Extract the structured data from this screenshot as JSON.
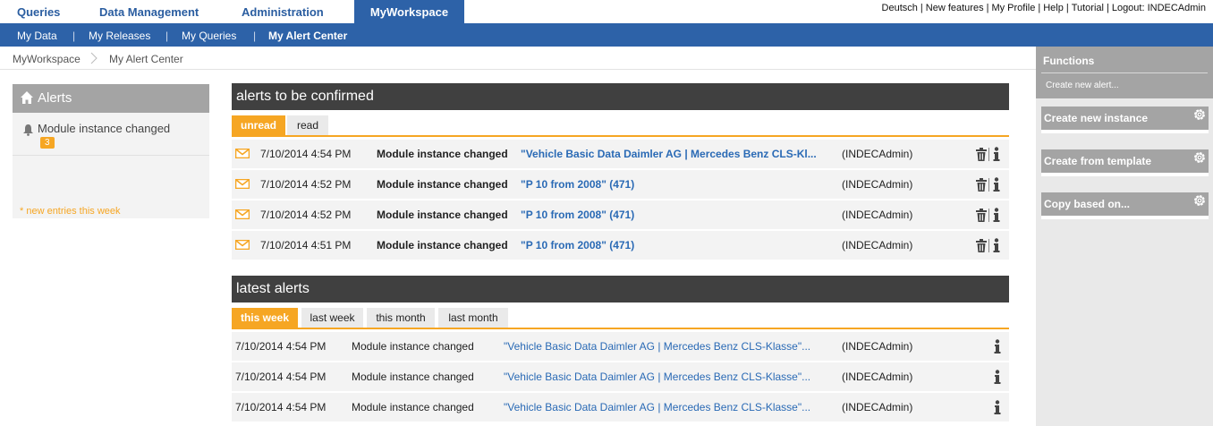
{
  "topnav": {
    "tabs": [
      {
        "label": "Queries"
      },
      {
        "label": "Data Management"
      },
      {
        "label": "Administration"
      },
      {
        "label": "MyWorkspace"
      }
    ],
    "utilities": {
      "language": "Deutsch",
      "new_features": "New features",
      "profile": "My Profile",
      "help": "Help",
      "tutorial": "Tutorial",
      "logout": "Logout: INDECAdmin"
    }
  },
  "subnav": {
    "items": [
      {
        "label": "My Data"
      },
      {
        "label": "My Releases"
      },
      {
        "label": "My Queries"
      },
      {
        "label": "My Alert Center"
      }
    ],
    "separator": "|"
  },
  "breadcrumb": [
    "MyWorkspace",
    "My Alert Center"
  ],
  "alerts_panel": {
    "title": "Alerts",
    "item_label": "Module instance changed",
    "item_count": "3",
    "note": "* new entries this week"
  },
  "confirm_section": {
    "title": "alerts to be confirmed",
    "tabs": [
      "unread",
      "read"
    ],
    "rows": [
      {
        "date": "7/10/2014 4:54 PM",
        "type": "Module instance changed",
        "target": "\"Vehicle Basic Data Daimler AG | Mercedes Benz CLS-Kl...",
        "user": "(INDECAdmin)"
      },
      {
        "date": "7/10/2014 4:52 PM",
        "type": "Module instance changed",
        "target": "\"P 10 from 2008\" (471)",
        "user": "(INDECAdmin)"
      },
      {
        "date": "7/10/2014 4:52 PM",
        "type": "Module instance changed",
        "target": "\"P 10 from 2008\" (471)",
        "user": "(INDECAdmin)"
      },
      {
        "date": "7/10/2014 4:51 PM",
        "type": "Module instance changed",
        "target": "\"P 10 from 2008\" (471)",
        "user": "(INDECAdmin)"
      }
    ]
  },
  "latest_section": {
    "title": "latest alerts",
    "tabs": [
      "this week",
      "last week",
      "this month",
      "last month"
    ],
    "rows": [
      {
        "date": "7/10/2014 4:54 PM",
        "type": "Module instance changed",
        "target": "\"Vehicle Basic Data Daimler AG | Mercedes Benz CLS-Klasse\"...",
        "user": "(INDECAdmin)"
      },
      {
        "date": "7/10/2014 4:54 PM",
        "type": "Module instance changed",
        "target": "\"Vehicle Basic Data Daimler AG | Mercedes Benz CLS-Klasse\"...",
        "user": "(INDECAdmin)"
      },
      {
        "date": "7/10/2014 4:54 PM",
        "type": "Module instance changed",
        "target": "\"Vehicle Basic Data Daimler AG | Mercedes Benz CLS-Klasse\"...",
        "user": "(INDECAdmin)"
      }
    ]
  },
  "functions_panel": {
    "title": "Functions",
    "link": "Create new alert...",
    "buttons": [
      "Create new instance",
      "Create from template",
      "Copy based on..."
    ]
  },
  "colors": {
    "nav_blue": "#2d62a8",
    "accent_orange": "#f6a623",
    "panel_gray": "#a4a4a4",
    "header_dark": "#404040",
    "link_blue": "#2a6ab5"
  },
  "icons": [
    "home-icon",
    "bell-icon",
    "envelope-icon",
    "trash-icon",
    "info-icon",
    "gear-icon",
    "chevron-right-icon"
  ]
}
